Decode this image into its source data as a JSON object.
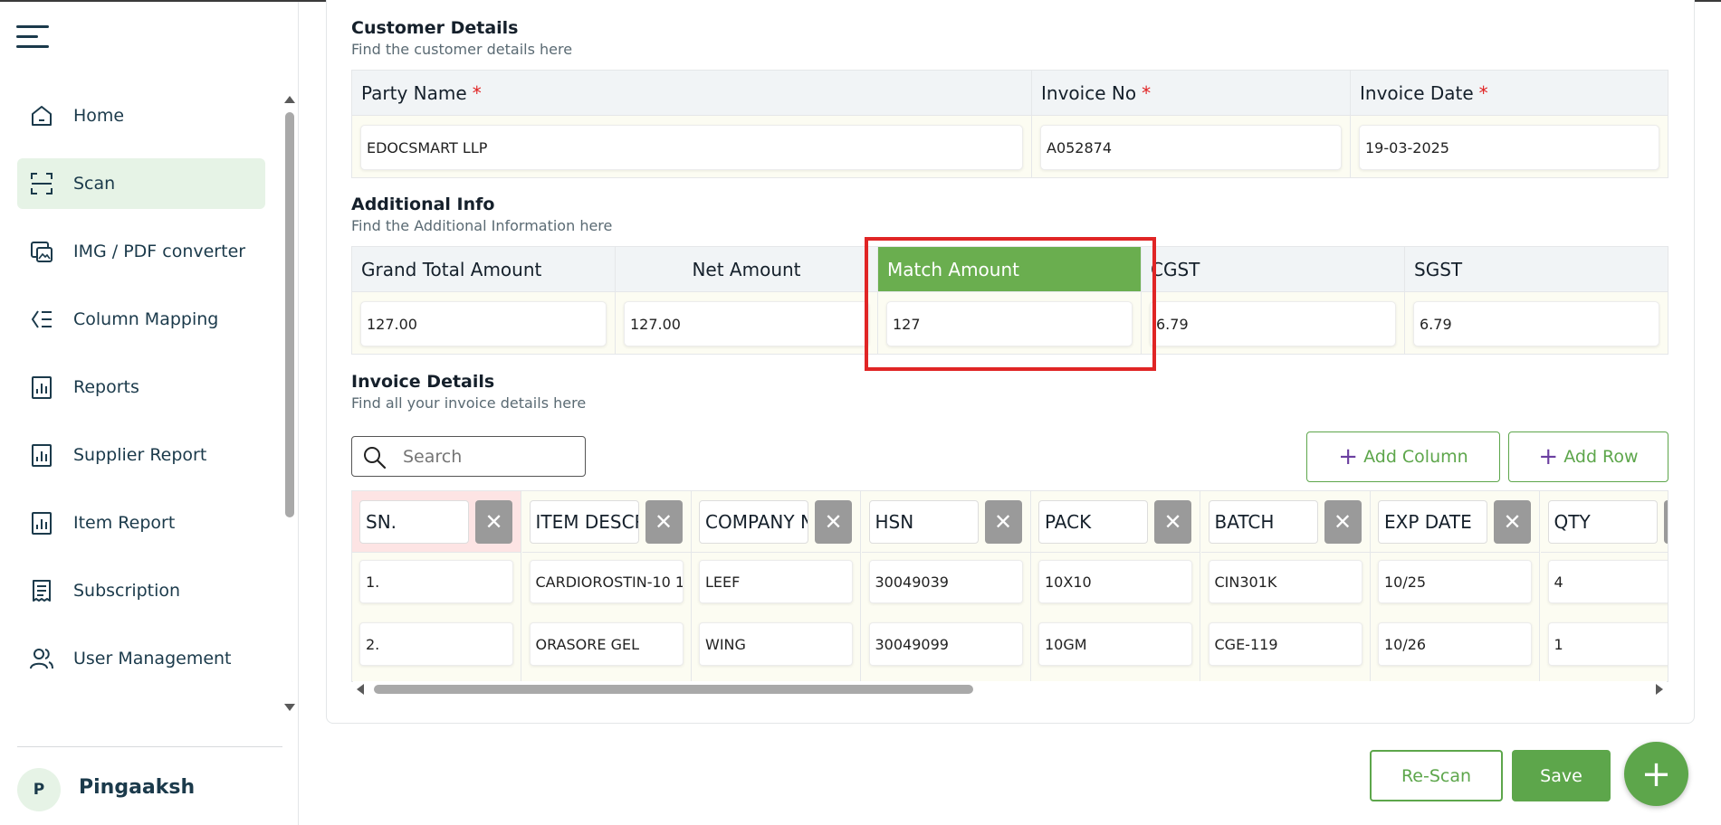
{
  "sidebar": {
    "items": [
      {
        "label": "Home",
        "icon": "home-icon"
      },
      {
        "label": "Scan",
        "icon": "scan-icon",
        "active": true
      },
      {
        "label": "IMG / PDF converter",
        "icon": "image-convert-icon"
      },
      {
        "label": "Column Mapping",
        "icon": "column-mapping-icon"
      },
      {
        "label": "Reports",
        "icon": "report-icon"
      },
      {
        "label": "Supplier Report",
        "icon": "report-icon"
      },
      {
        "label": "Item Report",
        "icon": "report-icon"
      },
      {
        "label": "Subscription",
        "icon": "subscription-icon"
      },
      {
        "label": "User Management",
        "icon": "users-icon"
      }
    ],
    "user": {
      "initial": "P",
      "name": "Pingaaksh"
    }
  },
  "customer": {
    "title": "Customer Details",
    "subtitle": "Find the customer details here",
    "fields": [
      {
        "label": "Party Name",
        "required": "*",
        "value": "EDOCSMART LLP"
      },
      {
        "label": "Invoice No",
        "required": "*",
        "value": "A052874"
      },
      {
        "label": "Invoice Date",
        "required": "*",
        "value": "19-03-2025"
      }
    ]
  },
  "additional": {
    "title": "Additional Info",
    "subtitle": "Find the Additional Information here",
    "fields": [
      {
        "label": "Grand Total Amount",
        "value": "127.00"
      },
      {
        "label": "Net Amount",
        "value": "127.00"
      },
      {
        "label": "Match Amount",
        "value": "127"
      },
      {
        "label": "CGST",
        "value": "6.79"
      },
      {
        "label": "SGST",
        "value": "6.79"
      }
    ]
  },
  "invoice": {
    "title": "Invoice Details",
    "subtitle": "Find all your invoice details here",
    "search_placeholder": "Search",
    "add_column": "Add Column",
    "add_row": "Add Row",
    "columns": [
      "SN.",
      "ITEM DESCR",
      "COMPANY N",
      "HSN",
      "PACK",
      "BATCH",
      "EXP DATE",
      "QTY"
    ],
    "rows": [
      [
        "1.",
        "CARDIOROSTIN-10 1",
        "LEEF",
        "30049039",
        "10X10",
        "CIN301K",
        "10/25",
        "4"
      ],
      [
        "2.",
        "ORASORE GEL",
        "WING",
        "30049099",
        "10GM",
        "CGE-119",
        "10/26",
        "1"
      ]
    ]
  },
  "actions": {
    "rescan": "Re-Scan",
    "save": "Save",
    "fab": "+"
  },
  "colors": {
    "accent": "#5da64b",
    "highlight": "#e02525",
    "text": "#1b3a4b"
  }
}
